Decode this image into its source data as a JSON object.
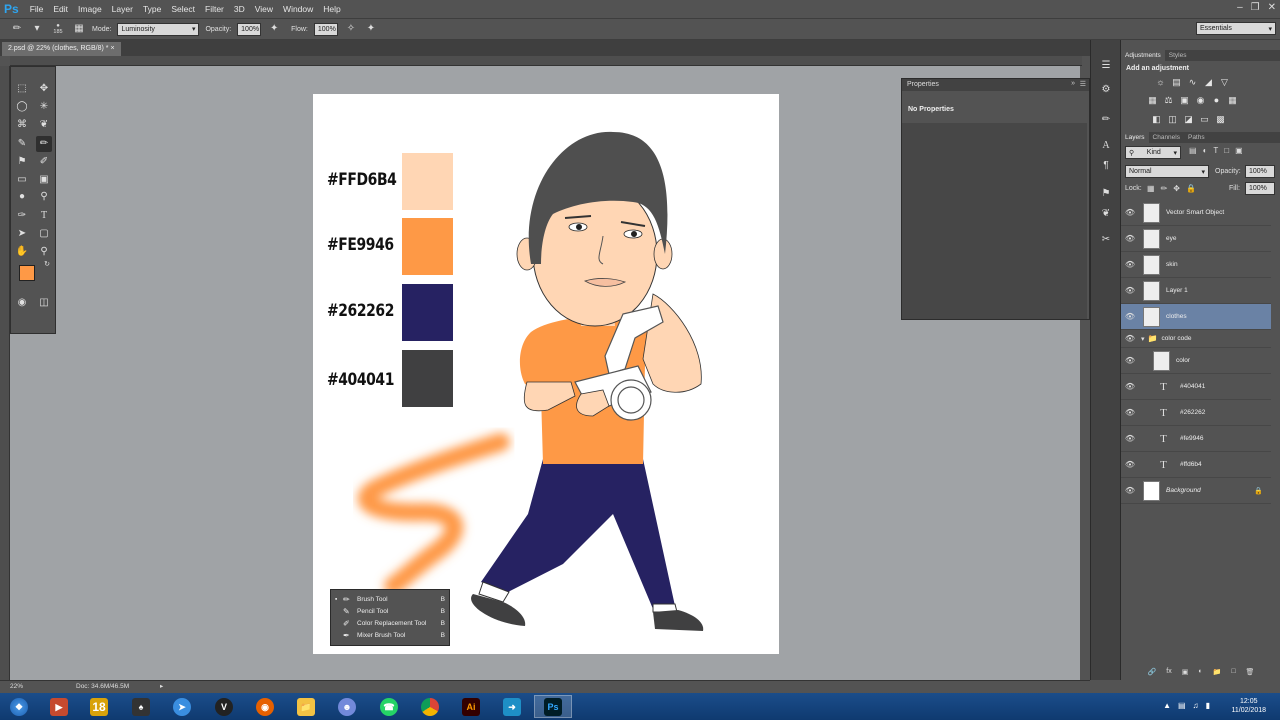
{
  "app": {
    "name": "Ps",
    "brand_color": "#2ea5f0"
  },
  "menu": [
    "File",
    "Edit",
    "Image",
    "Layer",
    "Type",
    "Select",
    "Filter",
    "3D",
    "View",
    "Window",
    "Help"
  ],
  "options_bar": {
    "brush_size": "185",
    "mode_label": "Mode:",
    "mode_value": "Luminosity",
    "opacity_label": "Opacity:",
    "opacity_value": "100%",
    "flow_label": "Flow:",
    "flow_value": "100%",
    "workspace": "Essentials"
  },
  "document": {
    "tab_title": "2.psd @ 22% (clothes, RGB/8) *"
  },
  "artwork": {
    "swatches": [
      {
        "label": "#FFD6B4",
        "color": "#FFD6B4"
      },
      {
        "label": "#FE9946",
        "color": "#FE9946"
      },
      {
        "label": "#262262",
        "color": "#262262"
      },
      {
        "label": "#404041",
        "color": "#404041"
      }
    ]
  },
  "tools": {
    "foreground": "#FE9946",
    "background": "#FFFFFF"
  },
  "brush_flyout": [
    {
      "name": "Brush Tool",
      "key": "B",
      "active": true
    },
    {
      "name": "Pencil Tool",
      "key": "B",
      "active": false
    },
    {
      "name": "Color Replacement Tool",
      "key": "B",
      "active": false
    },
    {
      "name": "Mixer Brush Tool",
      "key": "B",
      "active": false
    }
  ],
  "properties": {
    "title": "Properties",
    "body": "No Properties"
  },
  "adjustments": {
    "tabs": [
      "Adjustments",
      "Styles"
    ],
    "heading": "Add an adjustment"
  },
  "layers_panel": {
    "tabs": [
      "Layers",
      "Channels",
      "Paths"
    ],
    "filter": "Kind",
    "blend_mode": "Normal",
    "opacity_label": "Opacity:",
    "opacity": "100%",
    "lock_label": "Lock:",
    "fill_label": "Fill:",
    "fill": "100%",
    "layers": [
      {
        "name": "Vector Smart Object",
        "type": "smart",
        "selected": false
      },
      {
        "name": "eye",
        "type": "pixel",
        "selected": false
      },
      {
        "name": "skin",
        "type": "pixel",
        "selected": false
      },
      {
        "name": "Layer 1",
        "type": "pixel",
        "selected": false
      },
      {
        "name": "clothes",
        "type": "pixel",
        "selected": true
      },
      {
        "name": "color code",
        "type": "group",
        "selected": false
      },
      {
        "name": "color",
        "type": "pixel",
        "selected": false
      },
      {
        "name": "#404041",
        "type": "text",
        "selected": false
      },
      {
        "name": "#262262",
        "type": "text",
        "selected": false
      },
      {
        "name": "#fe9946",
        "type": "text",
        "selected": false
      },
      {
        "name": "#ffd6b4",
        "type": "text",
        "selected": false
      },
      {
        "name": "Background",
        "type": "background",
        "selected": false
      }
    ]
  },
  "status_bar": {
    "zoom": "22%",
    "doc": "Doc: 34.6M/46.5M"
  },
  "taskbar": {
    "time": "12:05",
    "date": "11/02/2018"
  }
}
